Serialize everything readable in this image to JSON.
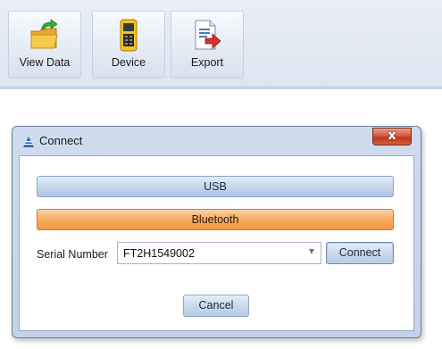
{
  "toolbar": {
    "buttons": [
      {
        "label": "View Data",
        "icon": "folder-arrow-icon"
      },
      {
        "label": "Device",
        "icon": "handheld-device-icon"
      },
      {
        "label": "Export",
        "icon": "export-document-icon"
      }
    ]
  },
  "dialog": {
    "title": "Connect",
    "close_label": "x",
    "usb_label": "USB",
    "bluetooth_label": "Bluetooth",
    "serial_label": "Serial Number",
    "serial_value": "FT2H1549002",
    "connect_label": "Connect",
    "cancel_label": "Cancel"
  },
  "colors": {
    "accent_orange": "#f7ab62",
    "accent_blue": "#c6d8ec",
    "close_red": "#c0391f"
  }
}
